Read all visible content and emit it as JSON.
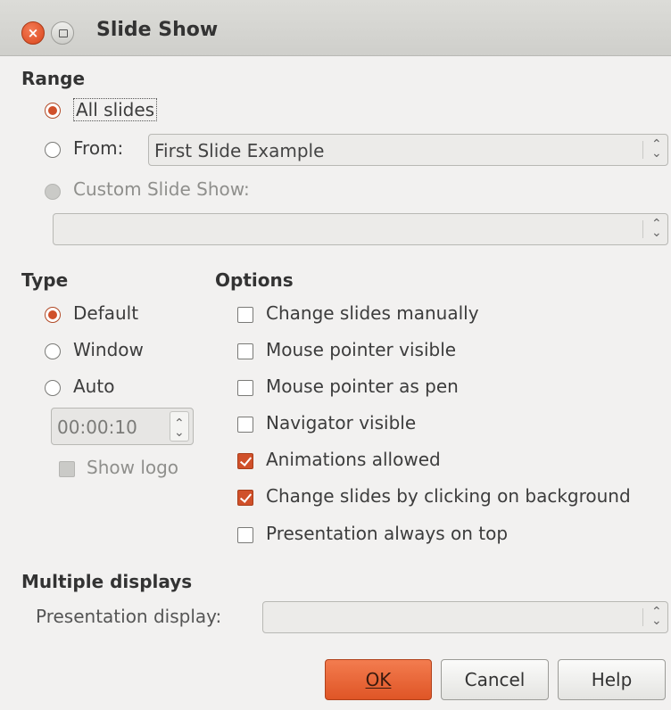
{
  "window": {
    "title": "Slide Show"
  },
  "range": {
    "heading": "Range",
    "all_slides": "All slides",
    "from_label": "From:",
    "from_value": "First Slide Example",
    "custom_label": "Custom Slide Show:",
    "custom_value": ""
  },
  "type": {
    "heading": "Type",
    "default": "Default",
    "window": "Window",
    "auto": "Auto",
    "auto_time": "00:00:10",
    "show_logo": "Show logo"
  },
  "options": {
    "heading": "Options",
    "items": [
      {
        "label": "Change slides manually",
        "checked": false
      },
      {
        "label": "Mouse pointer visible",
        "checked": false
      },
      {
        "label": "Mouse pointer as pen",
        "checked": false
      },
      {
        "label": "Navigator visible",
        "checked": false
      },
      {
        "label": "Animations allowed",
        "checked": true
      },
      {
        "label": "Change slides by clicking on background",
        "checked": true
      },
      {
        "label": "Presentation always on top",
        "checked": false
      }
    ]
  },
  "displays": {
    "heading": "Multiple displays",
    "presentation_label": "Presentation display:",
    "presentation_value": ""
  },
  "buttons": {
    "ok": "OK",
    "cancel": "Cancel",
    "help": "Help"
  },
  "colors": {
    "accent": "#d0502a",
    "background": "#f2f1f0"
  }
}
